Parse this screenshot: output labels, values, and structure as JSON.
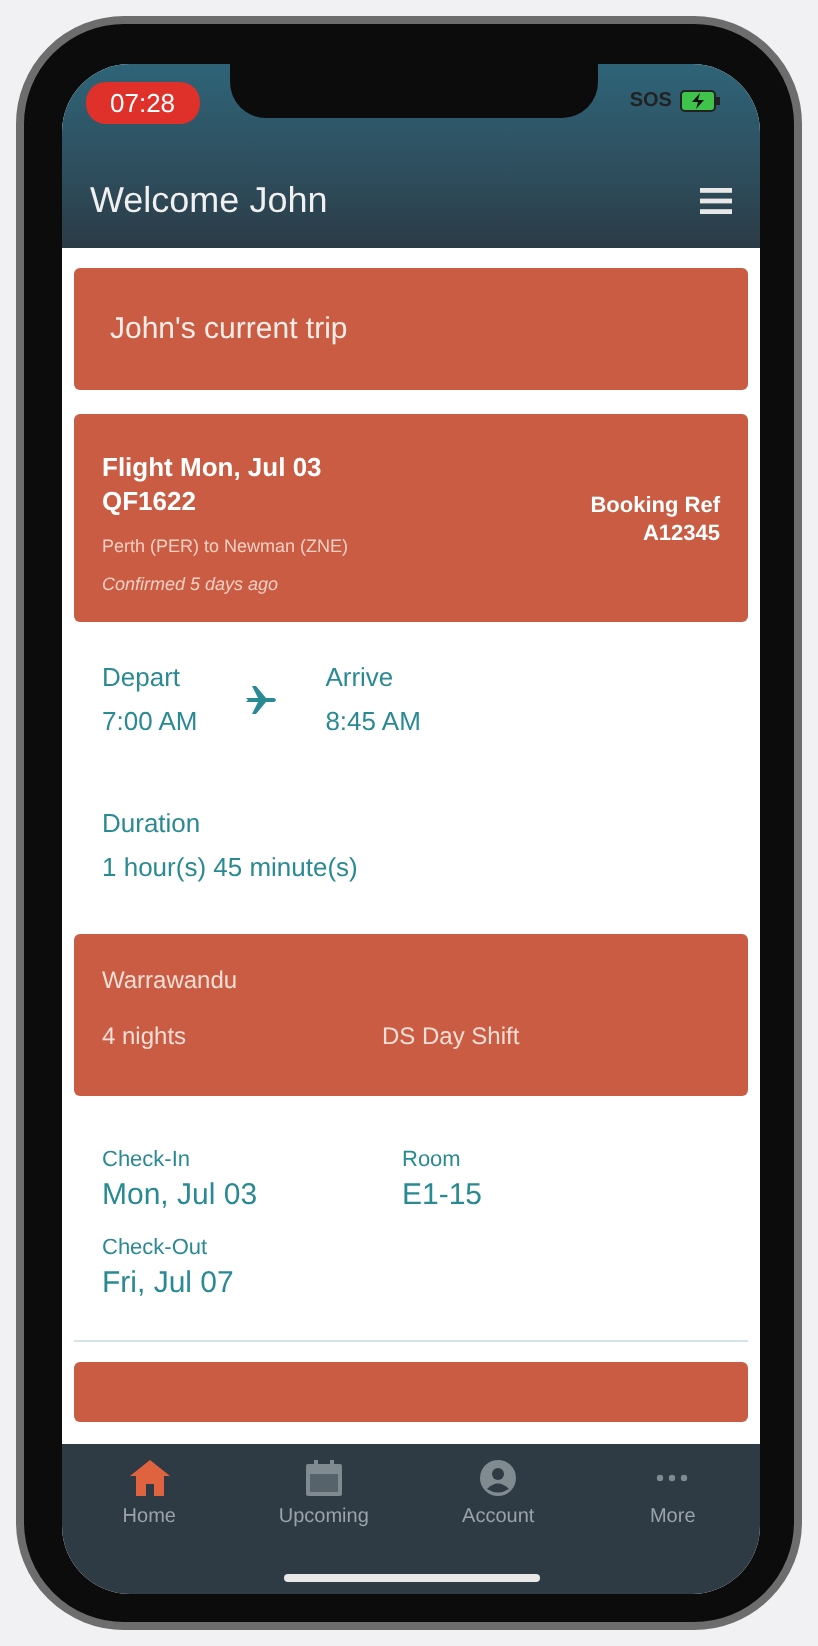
{
  "status_bar": {
    "time": "07:28",
    "carrier": "SOS"
  },
  "header": {
    "title": "Welcome John"
  },
  "trip_banner": {
    "title": "John's current trip"
  },
  "flight": {
    "title": "Flight Mon, Jul 03",
    "number": "QF1622",
    "route": "Perth (PER) to Newman (ZNE)",
    "confirmed": "Confirmed 5 days ago",
    "booking_ref_label": "Booking Ref",
    "booking_ref": "A12345",
    "depart_label": "Depart",
    "depart_time": "7:00 AM",
    "arrive_label": "Arrive",
    "arrive_time": "8:45 AM",
    "duration_label": "Duration",
    "duration": "1 hour(s) 45 minute(s)"
  },
  "accommodation": {
    "name": "Warrawandu",
    "nights": "4 nights",
    "shift": "DS Day Shift",
    "fields": [
      {
        "label": "Check-In",
        "value": "Mon, Jul 03"
      },
      {
        "label": "Room",
        "value": "E1-15"
      },
      {
        "label": "Check-Out",
        "value": "Fri, Jul 07"
      }
    ]
  },
  "tabs": [
    {
      "label": "Home",
      "kind": "home",
      "selected": true
    },
    {
      "label": "Upcoming",
      "kind": "calendar",
      "selected": false
    },
    {
      "label": "Account",
      "kind": "account",
      "selected": false
    },
    {
      "label": "More",
      "kind": "more",
      "selected": false
    }
  ]
}
